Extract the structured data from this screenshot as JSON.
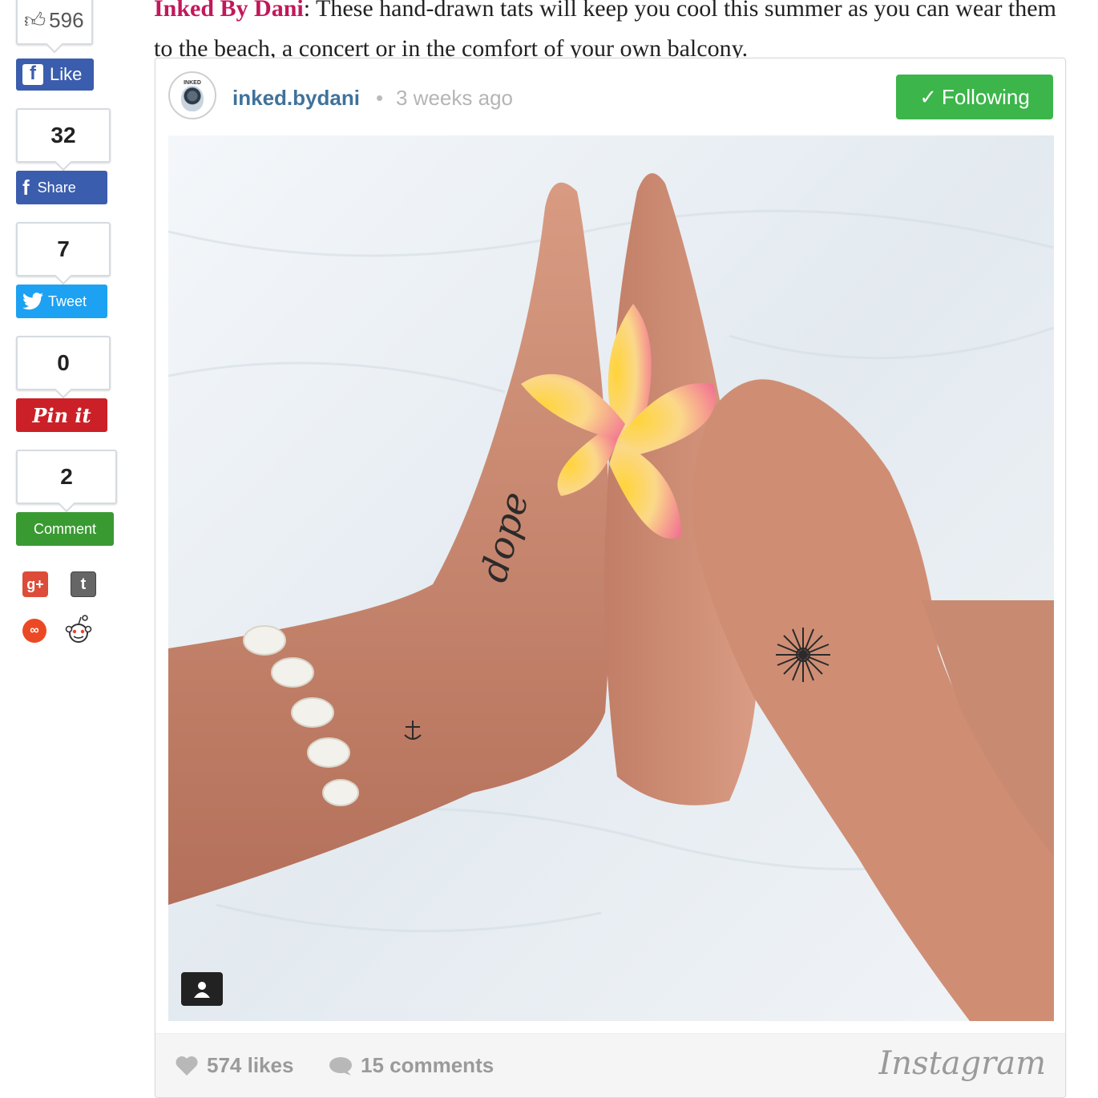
{
  "article": {
    "source_link": "Inked By Dani",
    "text": ": These hand-drawn tats will keep you cool this summer as you can wear them to the beach, a concert or in the comfort of your own balcony."
  },
  "share": {
    "like_count": "596",
    "like_label": "Like",
    "share_count": "32",
    "share_label": "Share",
    "tweet_count": "7",
    "tweet_label": "Tweet",
    "pin_count": "0",
    "pin_label": "Pin it",
    "comment_count": "2",
    "comment_label": "Comment",
    "colors": {
      "facebook": "#3b5dad",
      "twitter": "#1da1f2",
      "pinterest": "#cb2027",
      "comment": "#3a9a32",
      "googleplus": "#dd4b39",
      "tumblr": "#666666",
      "stumbleupon": "#eb4924"
    }
  },
  "instagram": {
    "avatar_text": "INKED",
    "username": "inked.bydani",
    "separator": "•",
    "time_ago": "3 weeks ago",
    "follow_label": "Following",
    "likes": "574 likes",
    "comments": "15 comments",
    "brand": "Instagram",
    "photo_tattoo_text": "dope",
    "colors": {
      "username": "#3f729b",
      "follow": "#3cb54a"
    }
  }
}
